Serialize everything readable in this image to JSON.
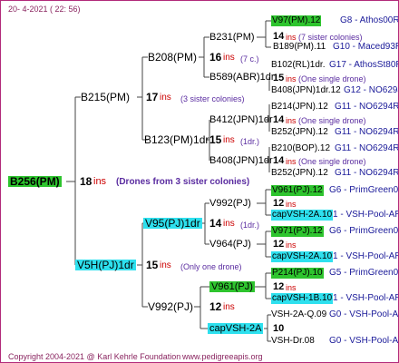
{
  "header": {
    "date": "20-   4-2021  ( 22: 56)"
  },
  "footer": {
    "copyright": "Copyright 2004-2021 @ Karl Kehrle Foundation",
    "site": "www.pedigreeapis.org"
  },
  "root": {
    "name": "B256(PM)",
    "ins": "18",
    "ins_word": "ins",
    "note": "(Drones from 3 sister colonies)"
  },
  "sire": {
    "name": "B215(PM)",
    "ins": "17",
    "ins_word": "ins",
    "note": "(3 sister colonies)"
  },
  "dam": {
    "name": "V5H(PJ)1dr",
    "ins": "15",
    "ins_word": "ins",
    "note": "(Only one drone)"
  },
  "b208": {
    "name": "B208(PM)",
    "ins": "16",
    "ins_word": "ins",
    "note": "(7 c.)"
  },
  "b123": {
    "name": "B123(PM)1dr",
    "ins": "15",
    "ins_word": "ins",
    "note": "(1dr.)"
  },
  "v95": {
    "name": "V95(PJ)1dr",
    "ins": "14",
    "ins_word": "ins",
    "note": "(1dr.)"
  },
  "v992a": {
    "name": "V992(PJ)",
    "ins": "12",
    "ins_word": "ins"
  },
  "b231": {
    "name": "B231(PM)",
    "ins": "14",
    "ins_word": "ins",
    "note": "(7 sister colonies)"
  },
  "b589": {
    "name": "B589(ABR)1dr",
    "ins": "15",
    "ins_word": "ins",
    "note": "(One single drone)"
  },
  "b412": {
    "name": "B412(JPN)1dr",
    "ins": "14",
    "ins_word": "ins",
    "note": "(One single drone)"
  },
  "b408": {
    "name": "B408(JPN)1dr",
    "ins": "14",
    "ins_word": "ins",
    "note": "(One single drone)"
  },
  "v992b": {
    "name": "V992(PJ)",
    "ins": "12",
    "ins_word": "ins"
  },
  "v964": {
    "name": "V964(PJ)",
    "ins": "12",
    "ins_word": "ins"
  },
  "v961": {
    "name": "V961(PJ)",
    "ins": "12",
    "ins_word": "ins"
  },
  "capvsh2a": {
    "name": "capVSH-2A",
    "ins": "10"
  },
  "leaves": [
    {
      "name": "V97(PM).12",
      "right": "G8 - Athos00R"
    },
    {
      "name": "B189(PM).11",
      "right": "G10 - Maced93R"
    },
    {
      "name": "B102(RL)1dr.",
      "right": "G17 - AthosSt80R"
    },
    {
      "name": "B408(JPN)1dr.12",
      "right": "G12 - NO6294R"
    },
    {
      "name": "B214(JPN).12",
      "right": "G11 - NO6294R"
    },
    {
      "name": "B252(JPN).12",
      "right": "G11 - NO6294R"
    },
    {
      "name": "B210(BOP).12",
      "right": "G11 - NO6294R"
    },
    {
      "name": "B252(JPN).12",
      "right": "G11 - NO6294R"
    },
    {
      "name": "V961(PJ).12",
      "right": "G6 - PrimGreen00"
    },
    {
      "name": "capVSH-2A.10",
      "right": "1 - VSH-Pool-AR"
    },
    {
      "name": "V971(PJ).12",
      "right": "G6 - PrimGreen00"
    },
    {
      "name": "capVSH-2A.10",
      "right": "1 - VSH-Pool-AR"
    },
    {
      "name": "P214(PJ).10",
      "right": "G5 - PrimGreen00"
    },
    {
      "name": "capVSH-1B.10",
      "right": "1 - VSH-Pool-AR"
    },
    {
      "name": "VSH-2A-Q.09",
      "right": "G0 - VSH-Pool-AR"
    },
    {
      "name": "VSH-Dr.08",
      "right": "G0 - VSH-Pool-AR"
    }
  ],
  "colors": {
    "highlight_green": "#2ec42e",
    "highlight_cyan": "#2ee0ee",
    "ins_red": "#cc0000",
    "note_purple": "#5a2ca0",
    "leaf_blue": "#1a1a99"
  }
}
